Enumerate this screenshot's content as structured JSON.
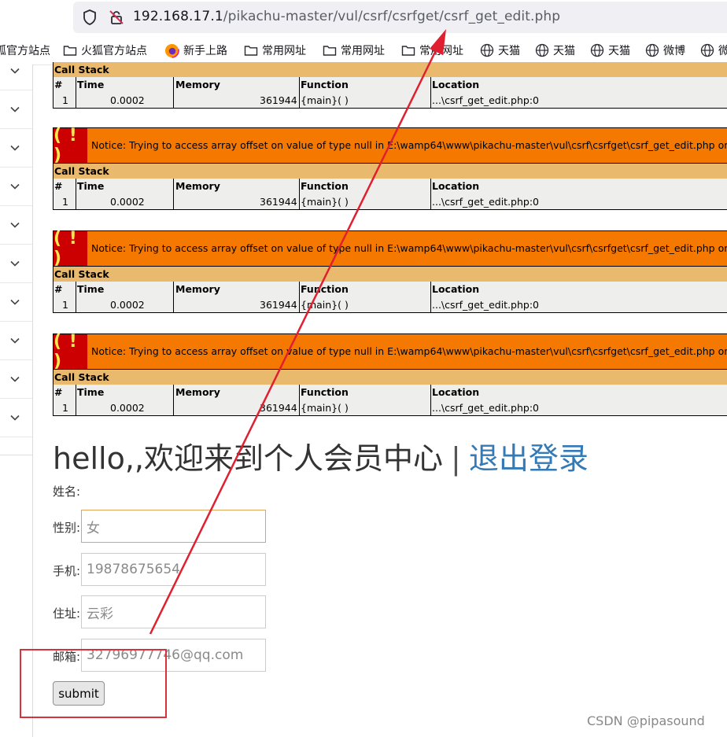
{
  "browser": {
    "url_host": "192.168.17.1",
    "url_path": "/pikachu-master/vul/csrf/csrfget/csrf_get_edit.php",
    "bookmarks": [
      {
        "label": "狐官方站点",
        "icon": "folder-icon"
      },
      {
        "label": "火狐官方站点",
        "icon": "folder-icon"
      },
      {
        "label": "新手上路",
        "icon": "firefox-icon"
      },
      {
        "label": "常用网址",
        "icon": "folder-icon"
      },
      {
        "label": "常用网址",
        "icon": "folder-icon"
      },
      {
        "label": "常用网址",
        "icon": "folder-icon"
      },
      {
        "label": "天猫",
        "icon": "globe-icon"
      },
      {
        "label": "天猫",
        "icon": "globe-icon"
      },
      {
        "label": "天猫",
        "icon": "globe-icon"
      },
      {
        "label": "微博",
        "icon": "globe-icon"
      },
      {
        "label": "微",
        "icon": "globe-icon"
      }
    ]
  },
  "xdebug": {
    "bang": "( ! )",
    "notice": "Notice: Trying to access array offset on value of type null in E:\\wamp64\\www\\pikachu-master\\vul\\csrf\\csrfget\\csrf_get_edit.php on line",
    "call_stack_label": "Call Stack",
    "headers": [
      "#",
      "Time",
      "Memory",
      "Function",
      "Location"
    ],
    "row": [
      "1",
      "0.0002",
      "361944",
      "{main}( )",
      "...\\csrf_get_edit.php:0"
    ]
  },
  "page": {
    "hello": "hello,,欢迎来到个人会员中心",
    "sep": "|",
    "logout": "退出登录",
    "form": {
      "name_label": "姓名:",
      "sex_label": "性别:",
      "sex_value": "女",
      "phone_label": "手机:",
      "phone_value": "19878675654",
      "address_label": "住址:",
      "address_value": "云彩",
      "email_label": "邮箱:",
      "email_value": "3279697774",
      "email_value_rest": "6@qq.com",
      "submit_label": "submit"
    }
  },
  "watermark": "CSDN @pipasound",
  "colors": {
    "notice_bg": "#f57900",
    "bang_bg": "#cc0000",
    "callstack_bg": "#e9b96e",
    "link": "#337ab7",
    "annotation": "#d8323c"
  }
}
